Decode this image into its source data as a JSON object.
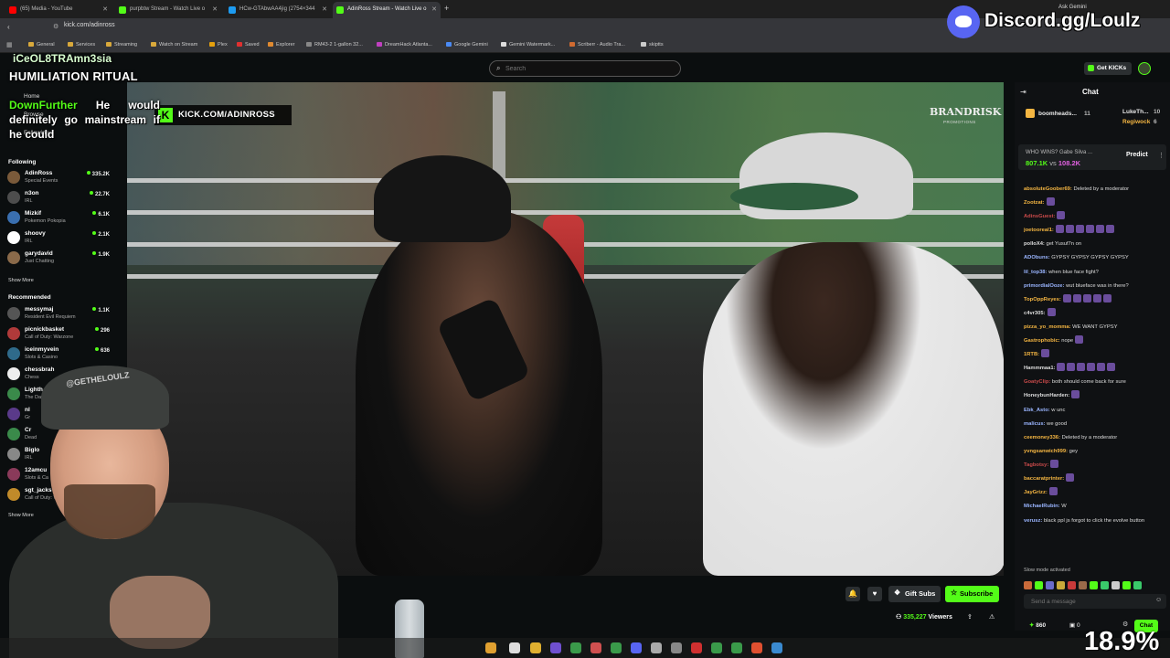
{
  "browser": {
    "tabs": [
      {
        "label": "(65) Media - YouTube",
        "color": "#ff0000",
        "active": false
      },
      {
        "label": "purpbtw Stream - Watch Live o",
        "color": "#53fc18",
        "active": false
      },
      {
        "label": "HCw-GTAbwAA4jig (2754×344",
        "color": "#1d9bf0",
        "active": false
      },
      {
        "label": "AdinRoss Stream - Watch Live o",
        "color": "#53fc18",
        "active": true
      }
    ],
    "url": "kick.com/adinross",
    "ask_label": "Ask Gemini",
    "bookmarks": [
      "General",
      "Services",
      "Streaming",
      "Watch on Stream",
      "Plex",
      "Saved",
      "Explorer",
      "RM43-2 1-gallon 32...",
      "DreamHack Atlanta...",
      "Google Gemini",
      "Gemini Watermark...",
      "Scriberr - Audio Tra...",
      "skiptts"
    ]
  },
  "kick_header": {
    "search_placeholder": "Search",
    "get_kicks_label": "Get KICKs"
  },
  "overlay": {
    "username_top": "iCeOL8TRAmn3sia",
    "title": "HUMILIATION  RITUAL",
    "msg_user": "DownFurther",
    "msg_text": " He would definitely go mainstream if he could"
  },
  "sidebar": {
    "home": "Home",
    "browse": "Browse",
    "following_nav": "Following",
    "following_header": "Following",
    "following": [
      {
        "name": "AdinRoss",
        "category": "Special Events",
        "viewers": "335.2K",
        "color": "#7a5a3a"
      },
      {
        "name": "n3on",
        "category": "IRL",
        "viewers": "22.7K",
        "color": "#4d4d4d"
      },
      {
        "name": "Mizkif",
        "category": "Pokemon Pokopia",
        "viewers": "6.1K",
        "color": "#3a6fb0"
      },
      {
        "name": "shoovy",
        "category": "IRL",
        "viewers": "2.1K",
        "color": "#ffffff"
      },
      {
        "name": "garydavid",
        "category": "Just Chatting",
        "viewers": "1.9K",
        "color": "#8a6a4a"
      }
    ],
    "show_more_1": "Show More",
    "recommended_header": "Recommended",
    "recommended": [
      {
        "name": "messymaj",
        "category": "Resident Evil Requiem",
        "viewers": "1.1K",
        "color": "#555"
      },
      {
        "name": "picnickbasket",
        "category": "Call of Duty: Warzone",
        "viewers": "296",
        "color": "#b03a3a"
      },
      {
        "name": "iceinmyvein",
        "category": "Slots & Casino",
        "viewers": "636",
        "color": "#2f6a8a"
      },
      {
        "name": "chessbrah",
        "category": "Chess",
        "viewers": "",
        "color": "#eee"
      },
      {
        "name": "Lighth",
        "category": "The Day",
        "viewers": "",
        "color": "#3a8a4a"
      },
      {
        "name": "nl",
        "category": "Gr",
        "viewers": "",
        "color": "#5a3a8a"
      },
      {
        "name": "Cr",
        "category": "Dead",
        "viewers": "",
        "color": "#3a8a4a"
      },
      {
        "name": "Biglo",
        "category": "IRL",
        "viewers": "",
        "color": "#888"
      },
      {
        "name": "12amcu",
        "category": "Slots & Ca",
        "viewers": "",
        "color": "#8a3a5a"
      },
      {
        "name": "sgt_jacks",
        "category": "Call of Duty: W",
        "viewers": "",
        "color": "#c08a2a"
      }
    ],
    "show_more_2": "Show More"
  },
  "video": {
    "promo_text": "KICK.COM/ADINROSS",
    "brand": "BRANDRISK",
    "brand_sub": "PROMOTIONS",
    "cam_hat_text": "@GETHELOULZ"
  },
  "actions": {
    "gift_subs": "Gift Subs",
    "subscribe": "Subscribe",
    "viewer_count": "335,227",
    "viewers_label": "Viewers"
  },
  "chat": {
    "title": "Chat",
    "leaderboard": [
      {
        "name": "boomheads...",
        "count": "11",
        "color": "#e0a9ff"
      },
      {
        "name": "LukeTh...",
        "count": "10",
        "color": "#ffffff"
      },
      {
        "name": "Regiwock",
        "count": "6",
        "color": "#f5b642"
      }
    ],
    "prediction_question": "WHO WINS? Gabe Silva ...",
    "prediction_a": "807.1K",
    "prediction_vs": "vs",
    "prediction_b": "108.2K",
    "predict_label": "Predict",
    "messages": [
      {
        "user": "absoluteGoober69:",
        "text": " Deleted by a moderator",
        "color": "#f5b642",
        "emotes": 0
      },
      {
        "user": "Zootzat:",
        "text": "",
        "color": "#f5b642",
        "emotes": 1
      },
      {
        "user": "AdinsGuest:",
        "text": "",
        "color": "#c94a4a",
        "emotes": 1
      },
      {
        "user": "joetooreal1:",
        "text": "",
        "color": "#f5b642",
        "emotes": 6
      },
      {
        "user": "polloX4:",
        "text": " get Yusuf7n on",
        "color": "#dddddd",
        "emotes": 0
      },
      {
        "user": "ADObuns:",
        "text": " GYPSY GYPSY GYPSY GYPSY",
        "color": "#9ab5ff",
        "emotes": 0
      },
      {
        "user": "lil_top38:",
        "text": " when blue face fight?",
        "color": "#9ab5ff",
        "emotes": 0
      },
      {
        "user": "primordialOoze:",
        "text": " wut blueface was in there?",
        "color": "#9ab5ff",
        "emotes": 0
      },
      {
        "user": "TopOppReyes:",
        "text": "",
        "color": "#f5b642",
        "emotes": 5
      },
      {
        "user": "c4vr305:",
        "text": "",
        "color": "#dddddd",
        "emotes": 1
      },
      {
        "user": "pizza_yo_momma:",
        "text": " WE WANT GYPSY",
        "color": "#f5b642",
        "emotes": 0
      },
      {
        "user": "Gastrophobic:",
        "text": " nope",
        "color": "#f5b642",
        "emotes": 1
      },
      {
        "user": "1RTB:",
        "text": "",
        "color": "#f5b642",
        "emotes": 1
      },
      {
        "user": "Hammmaa1:",
        "text": "",
        "color": "#dddddd",
        "emotes": 6
      },
      {
        "user": "GoatyClip:",
        "text": " both should come back for sure",
        "color": "#c94a4a",
        "emotes": 0
      },
      {
        "user": "HoneybunHarden:",
        "text": "",
        "color": "#dddddd",
        "emotes": 1
      },
      {
        "user": "Ebk_Asto:",
        "text": " w unc",
        "color": "#9ab5ff",
        "emotes": 0
      },
      {
        "user": "malicus:",
        "text": " we good",
        "color": "#9ab5ff",
        "emotes": 0
      },
      {
        "user": "ceemoney336:",
        "text": " Deleted by a moderator",
        "color": "#f5b642",
        "emotes": 0
      },
      {
        "user": "yvngsanwich999:",
        "text": " gey",
        "color": "#f5b642",
        "emotes": 0
      },
      {
        "user": "Tagbotsy:",
        "text": "",
        "color": "#c94a4a",
        "emotes": 1
      },
      {
        "user": "baccaratprinter:",
        "text": "",
        "color": "#f5b642",
        "emotes": 1
      },
      {
        "user": "JayGrizz:",
        "text": "",
        "color": "#f5b642",
        "emotes": 1
      },
      {
        "user": "MichaelRubin:",
        "text": " W",
        "color": "#9ab5ff",
        "emotes": 0
      }
    ],
    "last_message_user": "verusz:",
    "last_message_text": " black ppl js forgot to click the evolve button",
    "slow_mode": "Slow mode activated",
    "input_placeholder": "Send a message",
    "kicks_balance": "860",
    "kicks_other": "0",
    "send_label": "Chat"
  },
  "streamer_overlay": {
    "discord": "Discord.gg/Loulz",
    "percent": "18.9%"
  },
  "colors": {
    "kick_green": "#53fc18",
    "bg": "#0b0e0f",
    "panel": "#2b2f31"
  }
}
